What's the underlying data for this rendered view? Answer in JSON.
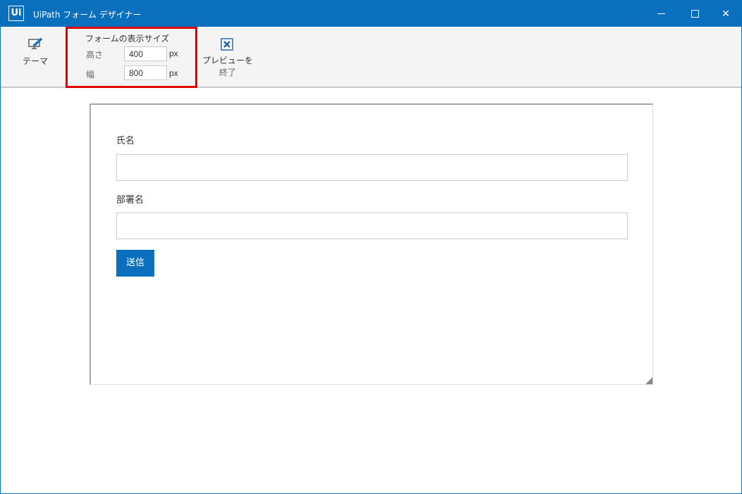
{
  "window": {
    "logo_text": "Ui",
    "title": "UiPath フォーム デザイナー",
    "controls": {
      "minimize": "minimize",
      "maximize": "maximize",
      "close": "✕"
    }
  },
  "toolbar": {
    "theme": {
      "label": "テーマ",
      "icon": "theme-icon"
    },
    "display_size": {
      "title": "フォームの表示サイズ",
      "height_label": "高さ",
      "height_value": "400",
      "width_label": "幅",
      "width_value": "800",
      "unit": "px",
      "highlight_color": "#e00000"
    },
    "end_preview": {
      "label_line1": "プレビューを",
      "label_line2": "終了",
      "icon": "close-box-icon"
    }
  },
  "form": {
    "fields": [
      {
        "label": "氏名",
        "value": ""
      },
      {
        "label": "部署名",
        "value": ""
      }
    ],
    "submit_label": "送信",
    "accent_color": "#0a70bd"
  }
}
